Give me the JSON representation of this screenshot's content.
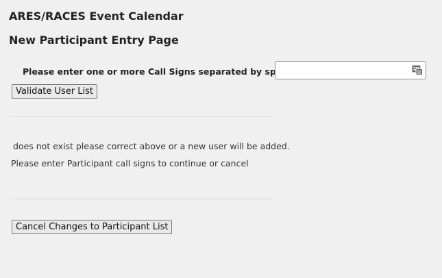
{
  "page": {
    "title": "ARES/RACES Event Calendar",
    "subtitle": "New Participant Entry Page"
  },
  "form": {
    "prompt_label": "Please enter one or more Call Signs separated by spaces",
    "callsign_value": "",
    "picker_icon": "keyboard-picker-icon",
    "validate_label": "Validate User List"
  },
  "messages": {
    "not_exist": " does not exist please correct above or a new user will be added.",
    "continue_prompt": "Please enter Participant call signs to continue or cancel"
  },
  "actions": {
    "cancel_label": "Cancel Changes to Participant List"
  }
}
